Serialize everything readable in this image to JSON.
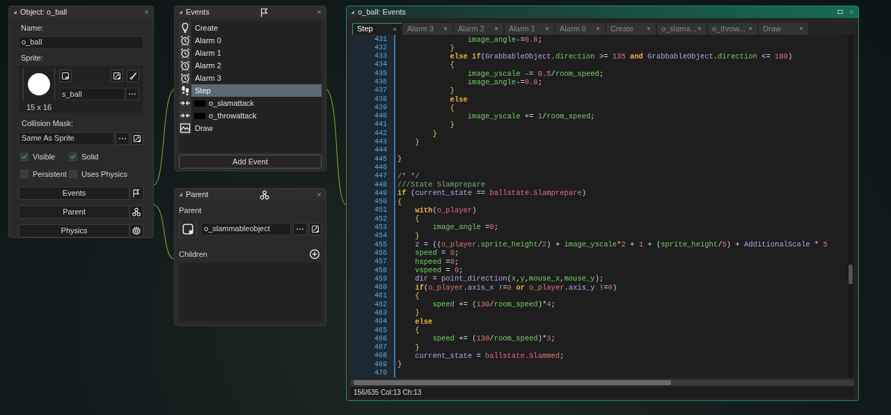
{
  "object_panel": {
    "title": "Object: o_ball",
    "name_label": "Name:",
    "name_value": "o_ball",
    "sprite_label": "Sprite:",
    "sprite_name": "s_ball",
    "sprite_size": "15 x 16",
    "collision_label": "Collision Mask:",
    "collision_value": "Same As Sprite",
    "checkboxes": [
      {
        "label": "Visible",
        "checked": true
      },
      {
        "label": "Solid",
        "checked": true
      },
      {
        "label": "Persistent",
        "checked": false
      },
      {
        "label": "Uses Physics",
        "checked": false
      }
    ],
    "buttons": [
      {
        "label": "Events",
        "kind": "events"
      },
      {
        "label": "Parent",
        "kind": "parent"
      },
      {
        "label": "Physics",
        "kind": "physics"
      }
    ]
  },
  "events_panel": {
    "title": "Events",
    "events": [
      {
        "label": "Create",
        "kind": "create",
        "selected": false
      },
      {
        "label": "Alarm 0",
        "kind": "alarm",
        "selected": false
      },
      {
        "label": "Alarm 1",
        "kind": "alarm",
        "selected": false
      },
      {
        "label": "Alarm 2",
        "kind": "alarm",
        "selected": false
      },
      {
        "label": "Alarm 3",
        "kind": "alarm",
        "selected": false
      },
      {
        "label": "Step",
        "kind": "step",
        "selected": true
      },
      {
        "label": "o_slamattack",
        "kind": "collision",
        "selected": false
      },
      {
        "label": "o_throwattack",
        "kind": "collision",
        "selected": false
      },
      {
        "label": "Draw",
        "kind": "draw",
        "selected": false
      }
    ],
    "add_button": "Add Event"
  },
  "parent_panel": {
    "title": "Parent",
    "parent_label": "Parent",
    "parent_value": "o_slammableobject",
    "children_label": "Children"
  },
  "editor": {
    "title": "o_ball: Events",
    "tabs": [
      {
        "label": "Step",
        "selected": true
      },
      {
        "label": "Alarm 3",
        "selected": false
      },
      {
        "label": "Alarm 2",
        "selected": false
      },
      {
        "label": "Alarm 1",
        "selected": false
      },
      {
        "label": "Alarm 0",
        "selected": false
      },
      {
        "label": "Create",
        "selected": false
      },
      {
        "label": "o_slama...",
        "selected": false
      },
      {
        "label": "o_throw...",
        "selected": false
      },
      {
        "label": "Draw",
        "selected": false
      }
    ],
    "lines": [
      {
        "number": "431",
        "segments": [
          {
            "text": "                image_angle",
            "kind": "variable"
          },
          {
            "text": "-=",
            "kind": "plain"
          },
          {
            "text": "0.8",
            "kind": "number"
          },
          {
            "text": ";",
            "kind": "plain"
          }
        ]
      },
      {
        "number": "432",
        "segments": [
          {
            "text": "            }",
            "kind": "brace"
          }
        ]
      },
      {
        "number": "433",
        "segments": [
          {
            "text": "            else if",
            "kind": "keyword"
          },
          {
            "text": "(",
            "kind": "plain"
          },
          {
            "text": "GrabbableObject",
            "kind": "identifier"
          },
          {
            "text": ".",
            "kind": "plain"
          },
          {
            "text": "direction",
            "kind": "variable"
          },
          {
            "text": " >= ",
            "kind": "plain"
          },
          {
            "text": "135",
            "kind": "number"
          },
          {
            "text": " and ",
            "kind": "keyword"
          },
          {
            "text": "GrabbableObject",
            "kind": "identifier"
          },
          {
            "text": ".",
            "kind": "plain"
          },
          {
            "text": "direction",
            "kind": "variable"
          },
          {
            "text": " <= ",
            "kind": "plain"
          },
          {
            "text": "180",
            "kind": "number"
          },
          {
            "text": ")",
            "kind": "plain"
          }
        ]
      },
      {
        "number": "434",
        "segments": [
          {
            "text": "            {",
            "kind": "brace"
          }
        ]
      },
      {
        "number": "435",
        "segments": [
          {
            "text": "                image_yscale",
            "kind": "variable"
          },
          {
            "text": " -= ",
            "kind": "plain"
          },
          {
            "text": "0.5",
            "kind": "number"
          },
          {
            "text": "/",
            "kind": "plain"
          },
          {
            "text": "room_speed",
            "kind": "variable"
          },
          {
            "text": ";",
            "kind": "plain"
          }
        ]
      },
      {
        "number": "436",
        "segments": [
          {
            "text": "                image_angle",
            "kind": "variable"
          },
          {
            "text": "-=",
            "kind": "plain"
          },
          {
            "text": "0.8",
            "kind": "number"
          },
          {
            "text": ";",
            "kind": "plain"
          }
        ]
      },
      {
        "number": "437",
        "segments": [
          {
            "text": "            }",
            "kind": "brace"
          }
        ]
      },
      {
        "number": "438",
        "segments": [
          {
            "text": "            else",
            "kind": "keyword"
          }
        ]
      },
      {
        "number": "439",
        "segments": [
          {
            "text": "            {",
            "kind": "brace"
          }
        ]
      },
      {
        "number": "440",
        "segments": [
          {
            "text": "                image_yscale",
            "kind": "variable"
          },
          {
            "text": " += ",
            "kind": "plain"
          },
          {
            "text": "1",
            "kind": "number"
          },
          {
            "text": "/",
            "kind": "plain"
          },
          {
            "text": "room_speed",
            "kind": "variable"
          },
          {
            "text": ";",
            "kind": "plain"
          }
        ]
      },
      {
        "number": "441",
        "segments": [
          {
            "text": "            }",
            "kind": "brace"
          }
        ]
      },
      {
        "number": "442",
        "segments": [
          {
            "text": "        }",
            "kind": "brace"
          }
        ]
      },
      {
        "number": "443",
        "segments": [
          {
            "text": "    }",
            "kind": "brace"
          }
        ]
      },
      {
        "number": "444"
      },
      {
        "number": "445",
        "segments": [
          {
            "text": "}",
            "kind": "brace"
          }
        ]
      },
      {
        "number": "446"
      },
      {
        "number": "447",
        "segments": [
          {
            "text": "/* */",
            "kind": "comment"
          }
        ]
      },
      {
        "number": "448",
        "segments": [
          {
            "text": "///State Slamprepare",
            "kind": "comment"
          }
        ]
      },
      {
        "number": "449",
        "segments": [
          {
            "text": "if",
            "kind": "keyword"
          },
          {
            "text": " (",
            "kind": "plain"
          },
          {
            "text": "current_state",
            "kind": "identifier"
          },
          {
            "text": " == ",
            "kind": "plain"
          },
          {
            "text": "ballstate.Slamprepare",
            "kind": "resource"
          },
          {
            "text": ")",
            "kind": "plain"
          }
        ]
      },
      {
        "number": "450",
        "segments": [
          {
            "text": "{",
            "kind": "brace"
          }
        ]
      },
      {
        "number": "451",
        "segments": [
          {
            "text": "    with",
            "kind": "keyword"
          },
          {
            "text": "(",
            "kind": "plain"
          },
          {
            "text": "o_player",
            "kind": "resource"
          },
          {
            "text": ")",
            "kind": "plain"
          }
        ]
      },
      {
        "number": "452",
        "segments": [
          {
            "text": "    {",
            "kind": "brace"
          }
        ]
      },
      {
        "number": "453",
        "segments": [
          {
            "text": "        image_angle",
            "kind": "variable"
          },
          {
            "text": " =",
            "kind": "plain"
          },
          {
            "text": "0",
            "kind": "number"
          },
          {
            "text": ";",
            "kind": "plain"
          }
        ]
      },
      {
        "number": "454",
        "segments": [
          {
            "text": "    }",
            "kind": "brace"
          }
        ]
      },
      {
        "number": "455",
        "segments": [
          {
            "text": "    z",
            "kind": "identifier"
          },
          {
            "text": " = ((",
            "kind": "plain"
          },
          {
            "text": "o_player",
            "kind": "resource"
          },
          {
            "text": ".",
            "kind": "plain"
          },
          {
            "text": "sprite_height",
            "kind": "variable"
          },
          {
            "text": "/",
            "kind": "plain"
          },
          {
            "text": "2",
            "kind": "number"
          },
          {
            "text": ") + ",
            "kind": "plain"
          },
          {
            "text": "image_yscale",
            "kind": "variable"
          },
          {
            "text": "*",
            "kind": "plain"
          },
          {
            "text": "2",
            "kind": "number"
          },
          {
            "text": " + ",
            "kind": "plain"
          },
          {
            "text": "1",
            "kind": "number"
          },
          {
            "text": " + (",
            "kind": "plain"
          },
          {
            "text": "sprite_height",
            "kind": "variable"
          },
          {
            "text": "/",
            "kind": "plain"
          },
          {
            "text": "5",
            "kind": "number"
          },
          {
            "text": ") + ",
            "kind": "plain"
          },
          {
            "text": "AdditionalScale",
            "kind": "identifier"
          },
          {
            "text": " * ",
            "kind": "plain"
          },
          {
            "text": "5",
            "kind": "number"
          }
        ]
      },
      {
        "number": "456",
        "segments": [
          {
            "text": "    speed",
            "kind": "variable"
          },
          {
            "text": " = ",
            "kind": "plain"
          },
          {
            "text": "0",
            "kind": "number"
          },
          {
            "text": ";",
            "kind": "plain"
          }
        ]
      },
      {
        "number": "457",
        "segments": [
          {
            "text": "    hspeed",
            "kind": "variable"
          },
          {
            "text": " =",
            "kind": "plain"
          },
          {
            "text": "0",
            "kind": "number"
          },
          {
            "text": ";",
            "kind": "plain"
          }
        ]
      },
      {
        "number": "458",
        "segments": [
          {
            "text": "    vspeed",
            "kind": "variable"
          },
          {
            "text": " = ",
            "kind": "plain"
          },
          {
            "text": "0",
            "kind": "number"
          },
          {
            "text": ";",
            "kind": "plain"
          }
        ]
      },
      {
        "number": "459",
        "segments": [
          {
            "text": "    dir",
            "kind": "identifier"
          },
          {
            "text": " = ",
            "kind": "plain"
          },
          {
            "text": "point_direction",
            "kind": "identifier"
          },
          {
            "text": "(",
            "kind": "plain"
          },
          {
            "text": "x",
            "kind": "variable"
          },
          {
            "text": ",",
            "kind": "plain"
          },
          {
            "text": "y",
            "kind": "variable"
          },
          {
            "text": ",",
            "kind": "plain"
          },
          {
            "text": "mouse_x",
            "kind": "variable"
          },
          {
            "text": ",",
            "kind": "plain"
          },
          {
            "text": "mouse_y",
            "kind": "variable"
          },
          {
            "text": ");",
            "kind": "plain"
          }
        ]
      },
      {
        "number": "460",
        "segments": [
          {
            "text": "    if",
            "kind": "keyword"
          },
          {
            "text": "(",
            "kind": "plain"
          },
          {
            "text": "o_player",
            "kind": "resource"
          },
          {
            "text": ".",
            "kind": "plain"
          },
          {
            "text": "axis_x",
            "kind": "identifier"
          },
          {
            "text": " !=",
            "kind": "plain"
          },
          {
            "text": "0",
            "kind": "number"
          },
          {
            "text": " or ",
            "kind": "keyword"
          },
          {
            "text": "o_player",
            "kind": "resource"
          },
          {
            "text": ".",
            "kind": "plain"
          },
          {
            "text": "axis_y",
            "kind": "identifier"
          },
          {
            "text": " !=",
            "kind": "plain"
          },
          {
            "text": "0",
            "kind": "number"
          },
          {
            "text": ")",
            "kind": "plain"
          }
        ]
      },
      {
        "number": "461",
        "segments": [
          {
            "text": "    {",
            "kind": "brace"
          }
        ]
      },
      {
        "number": "462",
        "segments": [
          {
            "text": "        speed",
            "kind": "variable"
          },
          {
            "text": " += (",
            "kind": "plain"
          },
          {
            "text": "130",
            "kind": "number"
          },
          {
            "text": "/",
            "kind": "plain"
          },
          {
            "text": "room_speed",
            "kind": "variable"
          },
          {
            "text": ")*",
            "kind": "plain"
          },
          {
            "text": "4",
            "kind": "number"
          },
          {
            "text": ";",
            "kind": "plain"
          }
        ]
      },
      {
        "number": "463",
        "segments": [
          {
            "text": "    }",
            "kind": "brace"
          }
        ]
      },
      {
        "number": "464",
        "segments": [
          {
            "text": "    else",
            "kind": "keyword"
          }
        ]
      },
      {
        "number": "465",
        "segments": [
          {
            "text": "    {",
            "kind": "brace"
          }
        ]
      },
      {
        "number": "466",
        "segments": [
          {
            "text": "        speed",
            "kind": "variable"
          },
          {
            "text": " += (",
            "kind": "plain"
          },
          {
            "text": "130",
            "kind": "number"
          },
          {
            "text": "/",
            "kind": "plain"
          },
          {
            "text": "room_speed",
            "kind": "variable"
          },
          {
            "text": ")*",
            "kind": "plain"
          },
          {
            "text": "3",
            "kind": "number"
          },
          {
            "text": ";",
            "kind": "plain"
          }
        ]
      },
      {
        "number": "467",
        "segments": [
          {
            "text": "    }",
            "kind": "brace"
          }
        ]
      },
      {
        "number": "468",
        "segments": [
          {
            "text": "    current_state",
            "kind": "identifier"
          },
          {
            "text": " = ",
            "kind": "plain"
          },
          {
            "text": "ballstate.Slammed",
            "kind": "resource"
          },
          {
            "text": ";",
            "kind": "plain"
          }
        ]
      },
      {
        "number": "469",
        "segments": [
          {
            "text": "}",
            "kind": "brace"
          }
        ]
      },
      {
        "number": "470"
      }
    ],
    "status": "156/635 Col:13 Ch:13"
  }
}
